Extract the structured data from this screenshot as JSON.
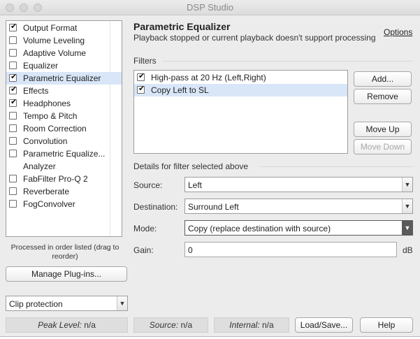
{
  "window": {
    "title": "DSP Studio"
  },
  "sidebar": {
    "items": [
      {
        "label": "Output Format",
        "checked": true,
        "selected": false
      },
      {
        "label": "Volume Leveling",
        "checked": false,
        "selected": false
      },
      {
        "label": "Adaptive Volume",
        "checked": false,
        "selected": false
      },
      {
        "label": "Equalizer",
        "checked": false,
        "selected": false
      },
      {
        "label": "Parametric Equalizer",
        "checked": true,
        "selected": true
      },
      {
        "label": "Effects",
        "checked": true,
        "selected": false
      },
      {
        "label": "Headphones",
        "checked": true,
        "selected": false
      },
      {
        "label": "Tempo & Pitch",
        "checked": false,
        "selected": false
      },
      {
        "label": "Room Correction",
        "checked": false,
        "selected": false
      },
      {
        "label": "Convolution",
        "checked": false,
        "selected": false
      },
      {
        "label": "Parametric Equalize...",
        "checked": false,
        "selected": false
      },
      {
        "label": "Analyzer",
        "checked": null,
        "selected": false
      },
      {
        "label": "FabFilter Pro-Q 2",
        "checked": false,
        "selected": false
      },
      {
        "label": "Reverberate",
        "checked": false,
        "selected": false
      },
      {
        "label": "FogConvolver",
        "checked": false,
        "selected": false
      }
    ],
    "note": "Processed in order listed (drag to reorder)",
    "manage_button": "Manage Plug-ins...",
    "clip_select": "Clip protection"
  },
  "main": {
    "title": "Parametric Equalizer",
    "subtitle": "Playback stopped or current playback doesn't support processing",
    "options_link": "Options",
    "filters_label": "Filters",
    "filters": [
      {
        "label": "High-pass at 20 Hz (Left,Right)",
        "checked": true,
        "selected": false
      },
      {
        "label": "Copy Left to SL",
        "checked": true,
        "selected": true
      }
    ],
    "buttons": {
      "add": "Add...",
      "remove": "Remove",
      "move_up": "Move Up",
      "move_down": "Move Down"
    },
    "details_label": "Details for filter selected above",
    "source_label": "Source:",
    "source_value": "Left",
    "destination_label": "Destination:",
    "destination_value": "Surround Left",
    "mode_label": "Mode:",
    "mode_value": "Copy (replace destination with source)",
    "gain_label": "Gain:",
    "gain_value": "0",
    "gain_unit": "dB"
  },
  "status": {
    "peak_label": "Peak Level:",
    "peak_value": "n/a",
    "source_label": "Source:",
    "source_value": "n/a",
    "internal_label": "Internal:",
    "internal_value": "n/a",
    "load_save": "Load/Save...",
    "help": "Help"
  },
  "icons": {
    "check": "checkmark-icon",
    "dropdown": "chevron-down-icon"
  },
  "colors": {
    "selection": "#d8e6f8",
    "window_bg": "#ececec"
  }
}
